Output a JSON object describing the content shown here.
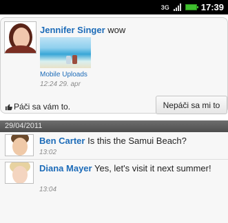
{
  "status_bar": {
    "network": "3G",
    "time": "17:39"
  },
  "post": {
    "author": "Jennifer Singer",
    "message": "wow",
    "album": "Mobile Uploads",
    "timestamp": "12:24 29. apr",
    "like_label": "Páči sa vám to.",
    "unlike_label": "Nepáči sa mi to"
  },
  "comments_section": {
    "date": "29/04/2011",
    "comments": [
      {
        "author": "Ben Carter",
        "text": "Is this the Samui Beach?",
        "time": "13:02"
      },
      {
        "author": "Diana Mayer",
        "text": "Yes, let's visit it next summer!",
        "time": "13:04"
      }
    ]
  }
}
